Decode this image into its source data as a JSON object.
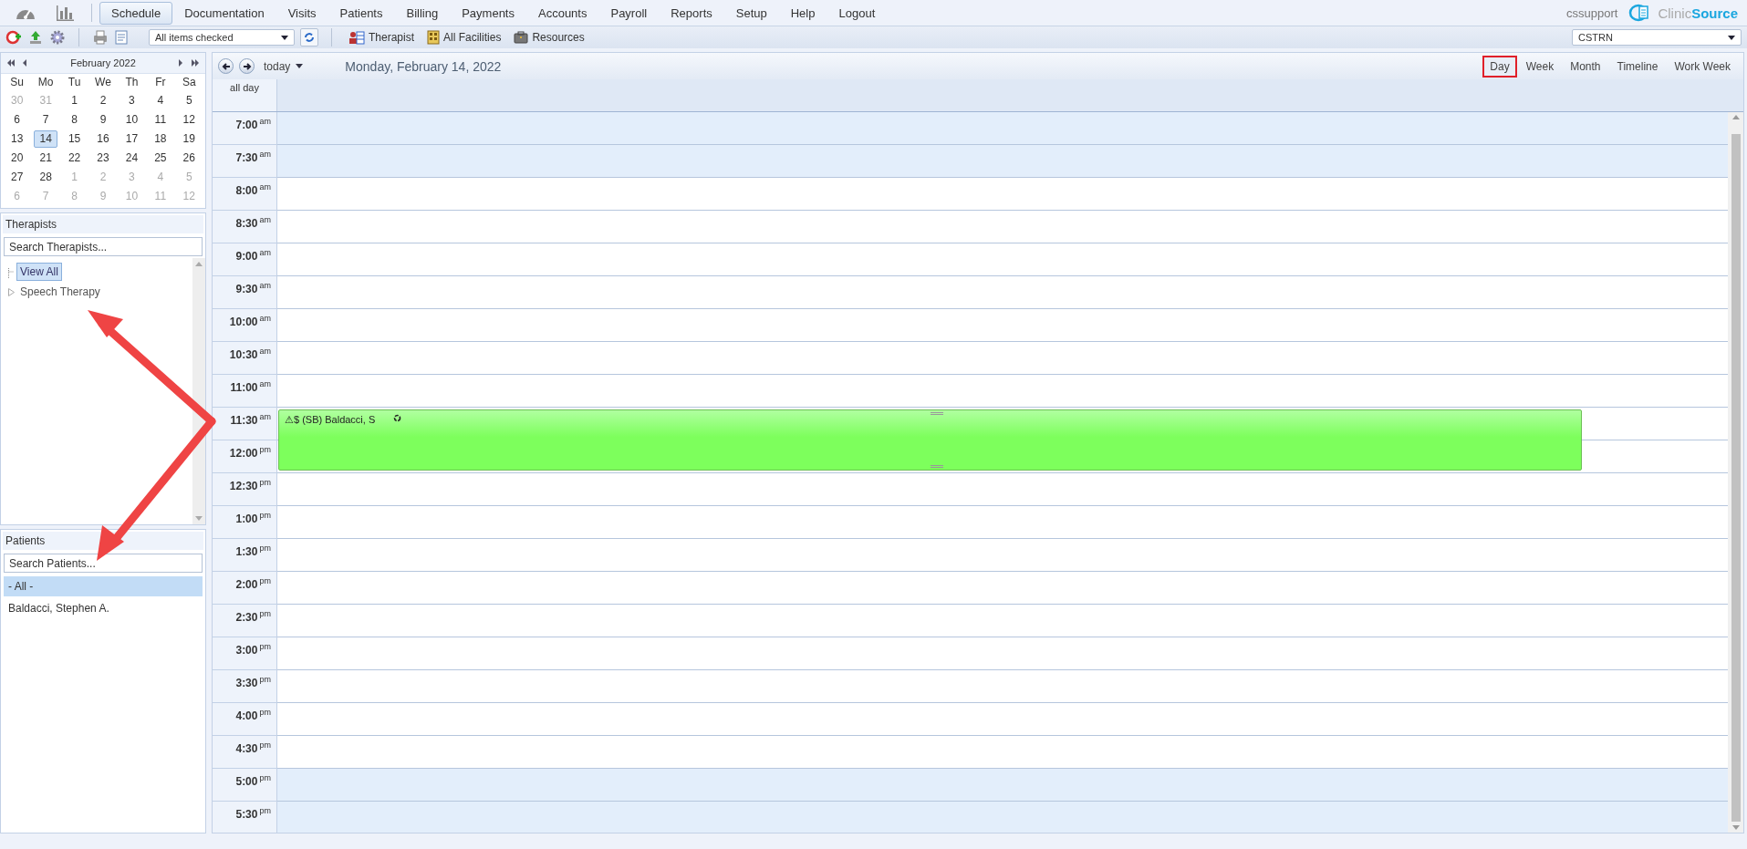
{
  "nav": {
    "items": [
      {
        "label": "Schedule",
        "selected": true
      },
      {
        "label": "Documentation",
        "selected": false
      },
      {
        "label": "Visits",
        "selected": false
      },
      {
        "label": "Patients",
        "selected": false
      },
      {
        "label": "Billing",
        "selected": false
      },
      {
        "label": "Payments",
        "selected": false
      },
      {
        "label": "Accounts",
        "selected": false
      },
      {
        "label": "Payroll",
        "selected": false
      },
      {
        "label": "Reports",
        "selected": false
      },
      {
        "label": "Setup",
        "selected": false
      },
      {
        "label": "Help",
        "selected": false
      },
      {
        "label": "Logout",
        "selected": false
      }
    ],
    "user": "cssupport",
    "logo": {
      "prefix": "Clinic",
      "suffix": "Source"
    }
  },
  "toolbar": {
    "filter": {
      "value": "All items checked"
    },
    "buttons": [
      {
        "kind": "therapist",
        "label": "Therapist"
      },
      {
        "kind": "facilities",
        "label": "All Facilities"
      },
      {
        "kind": "resources",
        "label": "Resources"
      }
    ],
    "location": {
      "value": "CSTRN"
    }
  },
  "mini_calendar": {
    "title": "February 2022",
    "weekdays": [
      "Su",
      "Mo",
      "Tu",
      "We",
      "Th",
      "Fr",
      "Sa"
    ],
    "days": [
      {
        "label": "30",
        "muted": true,
        "selected": false
      },
      {
        "label": "31",
        "muted": true,
        "selected": false
      },
      {
        "label": "1",
        "muted": false,
        "selected": false
      },
      {
        "label": "2",
        "muted": false,
        "selected": false
      },
      {
        "label": "3",
        "muted": false,
        "selected": false
      },
      {
        "label": "4",
        "muted": false,
        "selected": false
      },
      {
        "label": "5",
        "muted": false,
        "selected": false
      },
      {
        "label": "6",
        "muted": false,
        "selected": false
      },
      {
        "label": "7",
        "muted": false,
        "selected": false
      },
      {
        "label": "8",
        "muted": false,
        "selected": false
      },
      {
        "label": "9",
        "muted": false,
        "selected": false
      },
      {
        "label": "10",
        "muted": false,
        "selected": false
      },
      {
        "label": "11",
        "muted": false,
        "selected": false
      },
      {
        "label": "12",
        "muted": false,
        "selected": false
      },
      {
        "label": "13",
        "muted": false,
        "selected": false
      },
      {
        "label": "14",
        "muted": false,
        "selected": true
      },
      {
        "label": "15",
        "muted": false,
        "selected": false
      },
      {
        "label": "16",
        "muted": false,
        "selected": false
      },
      {
        "label": "17",
        "muted": false,
        "selected": false
      },
      {
        "label": "18",
        "muted": false,
        "selected": false
      },
      {
        "label": "19",
        "muted": false,
        "selected": false
      },
      {
        "label": "20",
        "muted": false,
        "selected": false
      },
      {
        "label": "21",
        "muted": false,
        "selected": false
      },
      {
        "label": "22",
        "muted": false,
        "selected": false
      },
      {
        "label": "23",
        "muted": false,
        "selected": false
      },
      {
        "label": "24",
        "muted": false,
        "selected": false
      },
      {
        "label": "25",
        "muted": false,
        "selected": false
      },
      {
        "label": "26",
        "muted": false,
        "selected": false
      },
      {
        "label": "27",
        "muted": false,
        "selected": false
      },
      {
        "label": "28",
        "muted": false,
        "selected": false
      },
      {
        "label": "1",
        "muted": true,
        "selected": false
      },
      {
        "label": "2",
        "muted": true,
        "selected": false
      },
      {
        "label": "3",
        "muted": true,
        "selected": false
      },
      {
        "label": "4",
        "muted": true,
        "selected": false
      },
      {
        "label": "5",
        "muted": true,
        "selected": false
      },
      {
        "label": "6",
        "muted": true,
        "selected": false
      },
      {
        "label": "7",
        "muted": true,
        "selected": false
      },
      {
        "label": "8",
        "muted": true,
        "selected": false
      },
      {
        "label": "9",
        "muted": true,
        "selected": false
      },
      {
        "label": "10",
        "muted": true,
        "selected": false
      },
      {
        "label": "11",
        "muted": true,
        "selected": false
      },
      {
        "label": "12",
        "muted": true,
        "selected": false
      }
    ]
  },
  "therapists": {
    "title": "Therapists",
    "search": {
      "placeholder": "Search Therapists..."
    },
    "tree": [
      {
        "label": "View All",
        "selected": true,
        "expandable": false
      },
      {
        "label": "Speech Therapy",
        "selected": false,
        "expandable": true
      }
    ]
  },
  "patients": {
    "title": "Patients",
    "search": {
      "placeholder": "Search Patients..."
    },
    "items": [
      {
        "label": "- All -",
        "selected": true
      },
      {
        "label": "Baldacci, Stephen A.",
        "selected": false
      }
    ]
  },
  "scheduler": {
    "today_label": "today",
    "date_title": "Monday, February 14, 2022",
    "views": [
      {
        "label": "Day",
        "selected": true
      },
      {
        "label": "Week",
        "selected": false
      },
      {
        "label": "Month",
        "selected": false
      },
      {
        "label": "Timeline",
        "selected": false
      },
      {
        "label": "Work Week",
        "selected": false
      }
    ],
    "all_day_label": "all day",
    "slots": [
      {
        "time": "7:00",
        "period": "am",
        "business": false
      },
      {
        "time": "7:30",
        "period": "am",
        "business": false
      },
      {
        "time": "8:00",
        "period": "am",
        "business": true
      },
      {
        "time": "8:30",
        "period": "am",
        "business": true
      },
      {
        "time": "9:00",
        "period": "am",
        "business": true
      },
      {
        "time": "9:30",
        "period": "am",
        "business": true
      },
      {
        "time": "10:00",
        "period": "am",
        "business": true
      },
      {
        "time": "10:30",
        "period": "am",
        "business": true
      },
      {
        "time": "11:00",
        "period": "am",
        "business": true
      },
      {
        "time": "11:30",
        "period": "am",
        "business": true,
        "event": {
          "title": "⚠$ (SB) Baldacci, S",
          "color": "#7dff5c",
          "recurring": true
        }
      },
      {
        "time": "12:00",
        "period": "pm",
        "business": true,
        "event_continues": true
      },
      {
        "time": "12:30",
        "period": "pm",
        "business": true
      },
      {
        "time": "1:00",
        "period": "pm",
        "business": true
      },
      {
        "time": "1:30",
        "period": "pm",
        "business": true
      },
      {
        "time": "2:00",
        "period": "pm",
        "business": true
      },
      {
        "time": "2:30",
        "period": "pm",
        "business": true
      },
      {
        "time": "3:00",
        "period": "pm",
        "business": true
      },
      {
        "time": "3:30",
        "period": "pm",
        "business": true
      },
      {
        "time": "4:00",
        "period": "pm",
        "business": true
      },
      {
        "time": "4:30",
        "period": "pm",
        "business": true
      },
      {
        "time": "5:00",
        "period": "pm",
        "business": false
      },
      {
        "time": "5:30",
        "period": "pm",
        "business": false
      }
    ]
  }
}
